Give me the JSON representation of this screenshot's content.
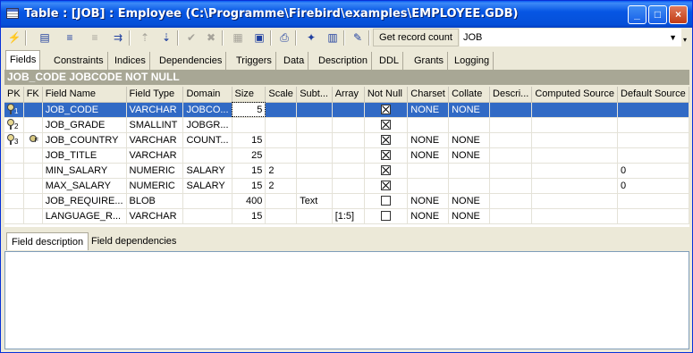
{
  "window": {
    "title": "Table : [JOB] : Employee (C:\\Programme\\Firebird\\examples\\EMPLOYEE.GDB)",
    "minimize": "_",
    "maximize": "□",
    "close": "×"
  },
  "toolbar": {
    "get_record_count": "Get record count",
    "table_select": "JOB"
  },
  "tabs": [
    "Fields",
    "Constraints",
    "Indices",
    "Dependencies",
    "Triggers",
    "Data",
    "Description",
    "DDL",
    "Grants",
    "Logging"
  ],
  "banner": "JOB_CODE JOBCODE NOT NULL",
  "grid": {
    "headers": [
      "PK",
      "FK",
      "Field Name",
      "Field Type",
      "Domain",
      "Size",
      "Scale",
      "Subt...",
      "Array",
      "Not Null",
      "Charset",
      "Collate",
      "Descri...",
      "Computed Source",
      "Default Source"
    ],
    "rows": [
      {
        "pk": "1",
        "fk": false,
        "name": "JOB_CODE",
        "type": "VARCHAR",
        "domain": "JOBCO...",
        "size": "5",
        "scale": "",
        "subtype": "",
        "array": "",
        "notnull": true,
        "charset": "NONE",
        "collate": "NONE",
        "desc": "",
        "computed": "",
        "default": ""
      },
      {
        "pk": "2",
        "fk": false,
        "name": "JOB_GRADE",
        "type": "SMALLINT",
        "domain": "JOBGR...",
        "size": "",
        "scale": "",
        "subtype": "",
        "array": "",
        "notnull": true,
        "charset": "",
        "collate": "",
        "desc": "",
        "computed": "",
        "default": ""
      },
      {
        "pk": "3",
        "fk": true,
        "name": "JOB_COUNTRY",
        "type": "VARCHAR",
        "domain": "COUNT...",
        "size": "15",
        "scale": "",
        "subtype": "",
        "array": "",
        "notnull": true,
        "charset": "NONE",
        "collate": "NONE",
        "desc": "",
        "computed": "",
        "default": ""
      },
      {
        "pk": "",
        "fk": false,
        "name": "JOB_TITLE",
        "type": "VARCHAR",
        "domain": "",
        "size": "25",
        "scale": "",
        "subtype": "",
        "array": "",
        "notnull": true,
        "charset": "NONE",
        "collate": "NONE",
        "desc": "",
        "computed": "",
        "default": ""
      },
      {
        "pk": "",
        "fk": false,
        "name": "MIN_SALARY",
        "type": "NUMERIC",
        "domain": "SALARY",
        "size": "15",
        "scale": "2",
        "subtype": "",
        "array": "",
        "notnull": true,
        "charset": "",
        "collate": "",
        "desc": "",
        "computed": "",
        "default": "0"
      },
      {
        "pk": "",
        "fk": false,
        "name": "MAX_SALARY",
        "type": "NUMERIC",
        "domain": "SALARY",
        "size": "15",
        "scale": "2",
        "subtype": "",
        "array": "",
        "notnull": true,
        "charset": "",
        "collate": "",
        "desc": "",
        "computed": "",
        "default": "0"
      },
      {
        "pk": "",
        "fk": false,
        "name": "JOB_REQUIRE...",
        "type": "BLOB",
        "domain": "",
        "size": "400",
        "scale": "",
        "subtype": "Text",
        "array": "",
        "notnull": false,
        "charset": "NONE",
        "collate": "NONE",
        "desc": "",
        "computed": "",
        "default": ""
      },
      {
        "pk": "",
        "fk": false,
        "name": "LANGUAGE_R...",
        "type": "VARCHAR",
        "domain": "",
        "size": "15",
        "scale": "",
        "subtype": "",
        "array": "[1:5]",
        "notnull": false,
        "charset": "NONE",
        "collate": "NONE",
        "desc": "",
        "computed": "",
        "default": ""
      }
    ]
  },
  "bottom_tabs": [
    "Field description",
    "Field dependencies"
  ]
}
